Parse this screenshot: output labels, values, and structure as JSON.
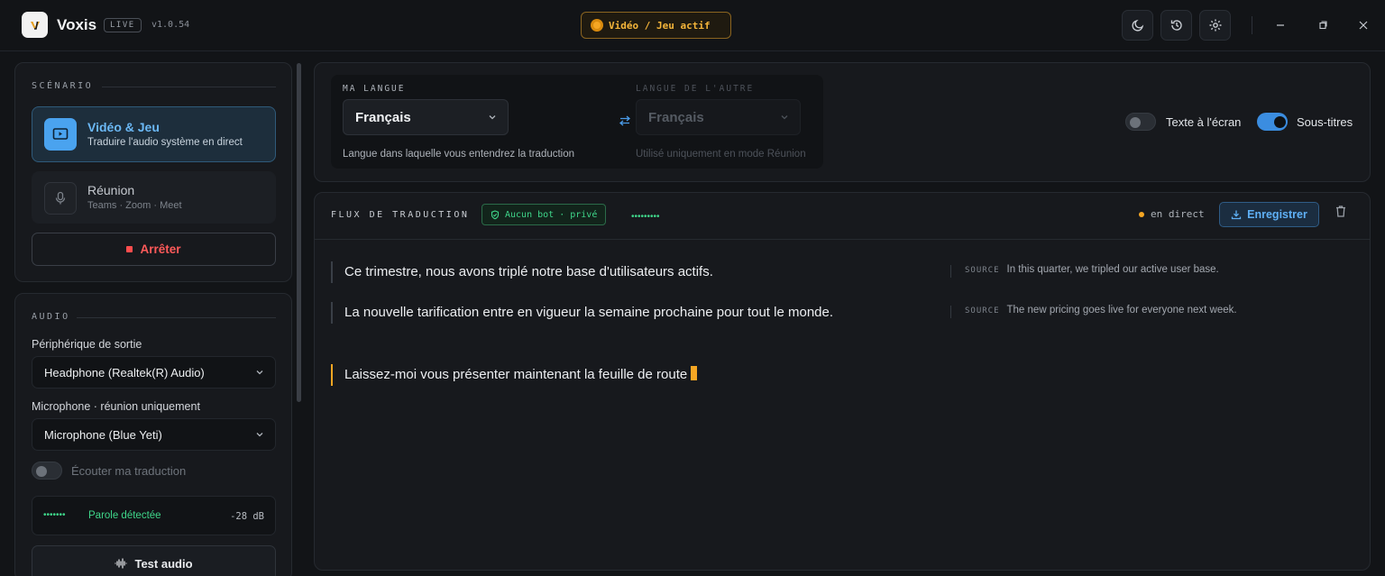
{
  "app": {
    "name": "Voxis",
    "badge": "LIVE",
    "version": "v1.0.54",
    "mode_pill": "Vidéo / Jeu actif"
  },
  "titlebar_icons": [
    "moon-icon",
    "history-icon",
    "gear-icon"
  ],
  "window_controls": [
    "minimize-icon",
    "restore-icon",
    "close-icon"
  ],
  "scenario": {
    "label": "SCÉNARIO",
    "items": [
      {
        "title": "Vidéo & Jeu",
        "subtitle": "Traduire l'audio système en direct",
        "active": true,
        "icon": "play-screen-icon"
      },
      {
        "title": "Réunion",
        "subtitle": "Teams · Zoom · Meet",
        "active": false,
        "icon": "microphone-icon"
      }
    ],
    "stop_label": "Arrêter"
  },
  "audio": {
    "label": "AUDIO",
    "output_label": "Périphérique de sortie",
    "output_value": "Headphone (Realtek(R) Audio)",
    "mic_label": "Microphone · réunion uniquement",
    "mic_value": "Microphone (Blue Yeti)",
    "monitor_label": "Écouter ma traduction",
    "monitor_on": false,
    "level_dots": "•••••••",
    "level_text": "Parole détectée",
    "level_db": "-28 dB",
    "test_label": "Test audio"
  },
  "languages": {
    "mine_label": "MA LANGUE",
    "mine_value": "Français",
    "mine_hint": "Langue dans laquelle vous entendrez la traduction",
    "other_label": "LANGUE DE L'AUTRE",
    "other_value": "Français",
    "other_hint": "Utilisé uniquement en mode Réunion",
    "swap_icon": "swap-arrows-icon"
  },
  "display_toggles": {
    "overlay_label": "Texte à l'écran",
    "overlay_on": false,
    "subtitles_label": "Sous-titres",
    "subtitles_on": true
  },
  "stream": {
    "title": "FLUX DE TRADUCTION",
    "privacy_badge": "Aucun bot · privé",
    "activity_dots": "•••••••••",
    "live_label": "en direct",
    "record_label": "Enregistrer",
    "source_tag": "SOURCE",
    "lines": [
      {
        "text": "Ce trimestre, nous avons triplé notre base d'utilisateurs actifs.",
        "source": "In this quarter, we tripled our active user base."
      },
      {
        "text": "La nouvelle tarification entre en vigueur la semaine prochaine pour tout le monde.",
        "source": "The new pricing goes live for everyone next week."
      },
      {
        "text": "Laissez-moi vous présenter maintenant la feuille de route",
        "source": ""
      }
    ]
  },
  "colors": {
    "accent_blue": "#3b8de0",
    "accent_orange": "#f5a623",
    "stop_red": "#ff5a5a",
    "ok_green": "#3fd68a"
  }
}
